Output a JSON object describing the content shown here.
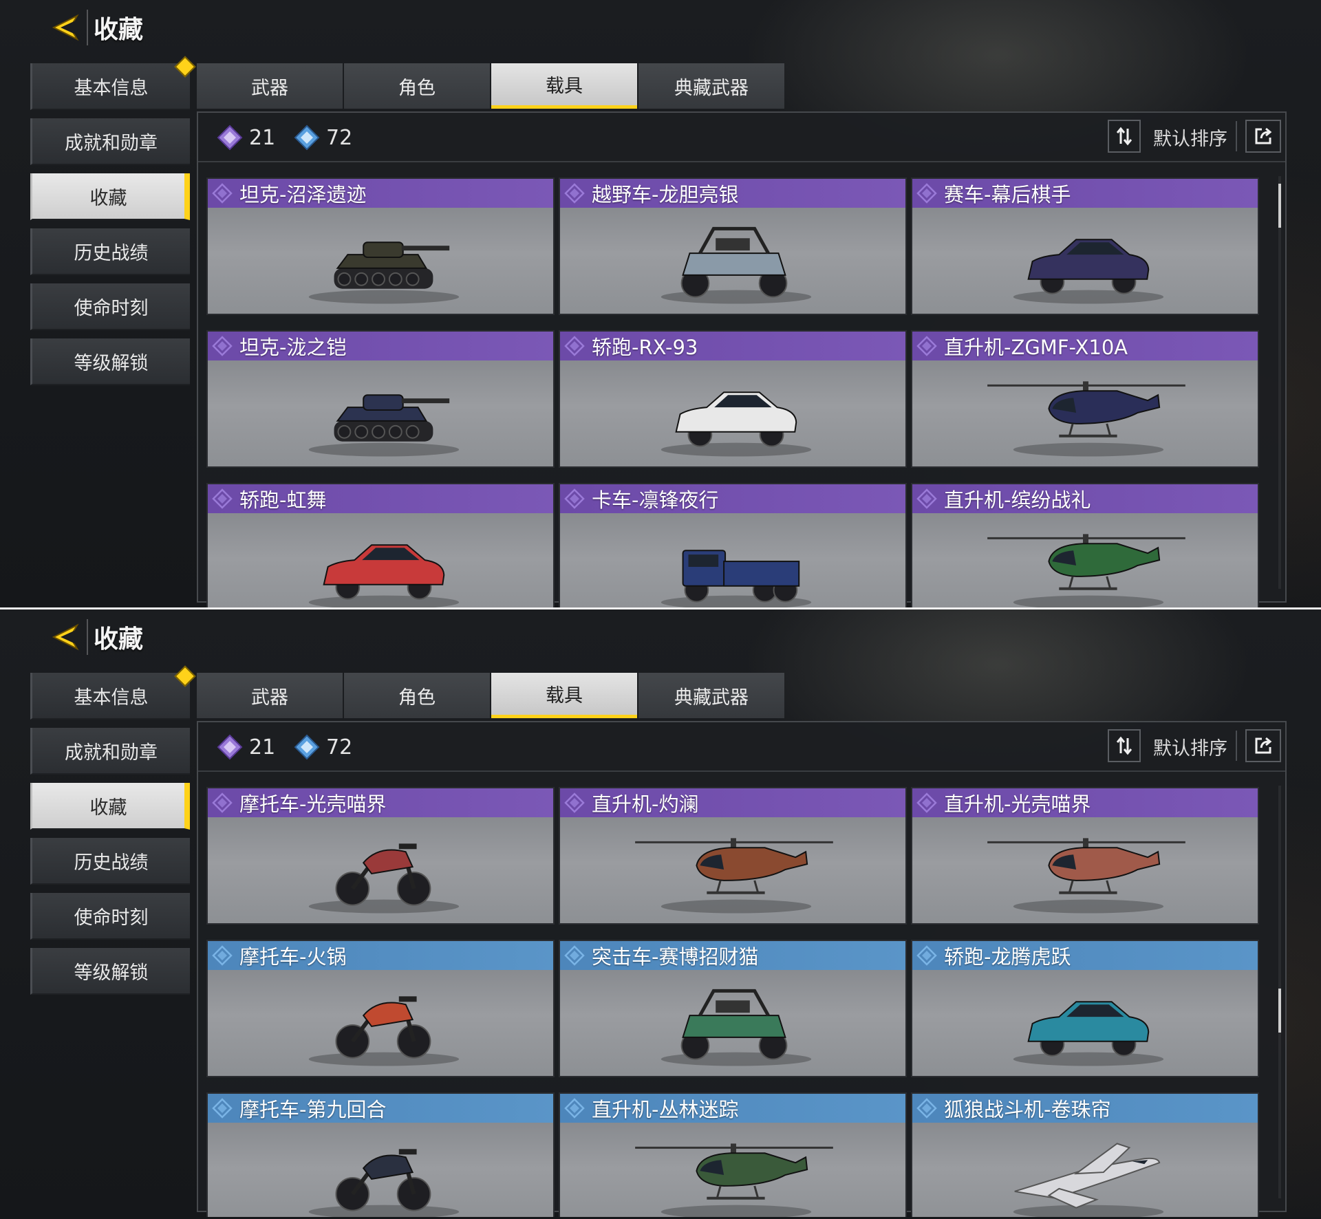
{
  "panels": [
    {
      "header": {
        "title": "收藏"
      },
      "sidebar": [
        {
          "label": "基本信息",
          "badge": true
        },
        {
          "label": "成就和勋章"
        },
        {
          "label": "收藏",
          "active": true
        },
        {
          "label": "历史战绩"
        },
        {
          "label": "使命时刻"
        },
        {
          "label": "等级解锁"
        }
      ],
      "tabs": [
        {
          "label": "武器"
        },
        {
          "label": "角色"
        },
        {
          "label": "载具",
          "active": true
        },
        {
          "label": "典藏武器"
        }
      ],
      "stats": {
        "purple_count": "21",
        "blue_count": "72"
      },
      "sort_label": "默认排序",
      "items": [
        {
          "name": "坦克-沼泽遗迹",
          "rarity": "purple",
          "icon": "tank-icon",
          "color": "#3a3a2e"
        },
        {
          "name": "越野车-龙胆亮银",
          "rarity": "purple",
          "icon": "buggy-icon",
          "color": "#8a9aa8"
        },
        {
          "name": "赛车-幕后棋手",
          "rarity": "purple",
          "icon": "car-icon",
          "color": "#35325e"
        },
        {
          "name": "坦克-泷之铠",
          "rarity": "purple",
          "icon": "tank-icon",
          "color": "#2c3350"
        },
        {
          "name": "轿跑-RX-93",
          "rarity": "purple",
          "icon": "car-icon",
          "color": "#e8e8e8"
        },
        {
          "name": "直升机-ZGMF-X10A",
          "rarity": "purple",
          "icon": "helicopter-icon",
          "color": "#2a2e58"
        },
        {
          "name": "轿跑-虹舞",
          "rarity": "purple",
          "icon": "car-icon",
          "color": "#c83a3a"
        },
        {
          "name": "卡车-凛锋夜行",
          "rarity": "purple",
          "icon": "truck-icon",
          "color": "#2a3d78"
        },
        {
          "name": "直升机-缤纷战礼",
          "rarity": "purple",
          "icon": "helicopter-icon",
          "color": "#2f6a3a"
        }
      ],
      "scroll_position": 0.02
    },
    {
      "header": {
        "title": "收藏"
      },
      "sidebar": [
        {
          "label": "基本信息",
          "badge": true
        },
        {
          "label": "成就和勋章"
        },
        {
          "label": "收藏",
          "active": true
        },
        {
          "label": "历史战绩"
        },
        {
          "label": "使命时刻"
        },
        {
          "label": "等级解锁"
        }
      ],
      "tabs": [
        {
          "label": "武器"
        },
        {
          "label": "角色"
        },
        {
          "label": "载具",
          "active": true
        },
        {
          "label": "典藏武器"
        }
      ],
      "stats": {
        "purple_count": "21",
        "blue_count": "72"
      },
      "sort_label": "默认排序",
      "items": [
        {
          "name": "摩托车-光壳喵界",
          "rarity": "purple",
          "icon": "motorcycle-icon",
          "color": "#9a3a3a"
        },
        {
          "name": "直升机-灼澜",
          "rarity": "purple",
          "icon": "helicopter-icon",
          "color": "#8a4a30"
        },
        {
          "name": "直升机-光壳喵界",
          "rarity": "purple",
          "icon": "helicopter-icon",
          "color": "#a05a4a"
        },
        {
          "name": "摩托车-火锅",
          "rarity": "blue",
          "icon": "motorcycle-icon",
          "color": "#c04a30"
        },
        {
          "name": "突击车-赛博招财猫",
          "rarity": "blue",
          "icon": "buggy-icon",
          "color": "#3a7a5a"
        },
        {
          "name": "轿跑-龙腾虎跃",
          "rarity": "blue",
          "icon": "car-icon",
          "color": "#2a8aa0"
        },
        {
          "name": "摩托车-第九回合",
          "rarity": "blue",
          "icon": "motorcycle-icon",
          "color": "#2a3040"
        },
        {
          "name": "直升机-丛林迷踪",
          "rarity": "blue",
          "icon": "helicopter-icon",
          "color": "#3a5a3a"
        },
        {
          "name": "狐狼战斗机-卷珠帘",
          "rarity": "blue",
          "icon": "jet-icon",
          "color": "#d8d8dc"
        }
      ],
      "scroll_position": 0.55
    }
  ],
  "colors": {
    "accent": "#ffd21a",
    "purple_rarity": "#7b58b6",
    "blue_rarity": "#5a95c8"
  }
}
